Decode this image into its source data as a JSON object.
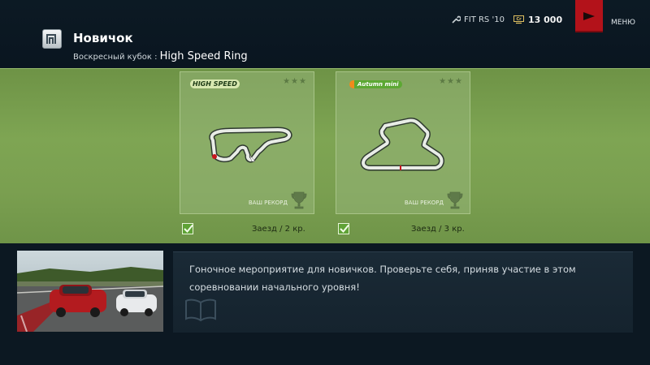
{
  "header": {
    "title": "Новичок",
    "subtitle_prefix": "Воскресный кубок : ",
    "track_name": "High Speed Ring",
    "car": "FIT RS '10",
    "credits": "13 000",
    "menu_label": "МЕНЮ"
  },
  "races": [
    {
      "logo_text": "HIGH SPEED",
      "stars": "★★★",
      "record_label": "ВАШ РЕКОРД",
      "race_info": "Заезд / 2 кр.",
      "completed": true
    },
    {
      "logo_text": "Autumn mini",
      "stars": "★★★",
      "record_label": "ВАШ РЕКОРД",
      "race_info": "Заезд / 3 кр.",
      "completed": true
    }
  ],
  "description": "Гоночное мероприятие для новичков. Проверьте себя, приняв участие в этом соревновании начального уровня!",
  "icons": {
    "mode": "mode-icon",
    "car": "wrench-icon",
    "credits": "credits-icon",
    "menu": "menu-arrow-icon",
    "trophy": "trophy-icon",
    "check": "checkbox-icon",
    "book": "book-icon"
  },
  "colors": {
    "accent_red": "#b3121a",
    "band_green": "#7ea553",
    "check_green": "#5fa236"
  }
}
